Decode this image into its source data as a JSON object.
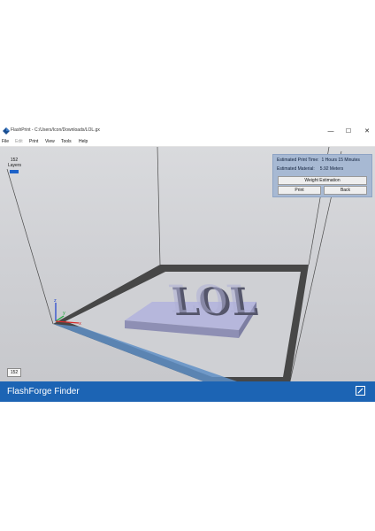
{
  "window": {
    "title": "FlashPrint - C:/Users/Icon/Downloads/LOL.gx",
    "controls": {
      "minimize": "—",
      "maximize": "☐",
      "close": "✕"
    }
  },
  "menu": {
    "items": [
      {
        "label": "File",
        "enabled": true
      },
      {
        "label": "Edit",
        "enabled": false
      },
      {
        "label": "Print",
        "enabled": true
      },
      {
        "label": "View",
        "enabled": true
      },
      {
        "label": "Tools",
        "enabled": true
      },
      {
        "label": "Help",
        "enabled": true
      }
    ]
  },
  "layers": {
    "count": "152",
    "unit": "Layers",
    "bottom_value": "152"
  },
  "info_panel": {
    "print_time_label": "Estimated Print Time:",
    "print_time_value": "1 Hours 15 Minutes",
    "material_label": "Estimated Material:",
    "material_value": "5.92 Meters",
    "weight_button": "Weight Estimation",
    "print_button": "Print",
    "back_button": "Back"
  },
  "model": {
    "text": "LOL",
    "color": "#a9a9d1"
  },
  "axes": {
    "x": "x",
    "y": "y",
    "z": "z"
  },
  "footer": {
    "title": "FlashForge Finder",
    "accent": "#1c64b4"
  },
  "colors": {
    "accent": "#1c62c8",
    "panel": "#a7b9d3",
    "viewport": "#d0d1d5"
  }
}
